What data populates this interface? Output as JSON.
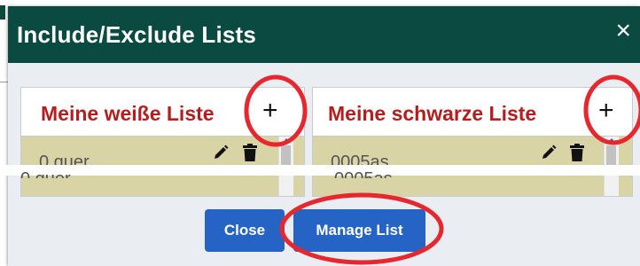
{
  "dialog": {
    "title": "Include/Exclude Lists",
    "close_glyph": "×"
  },
  "lists": [
    {
      "title": "Meine weiße Liste",
      "add_glyph": "+",
      "first_item": "0 quer",
      "edit_icon": "pencil-icon",
      "delete_icon": "trash-icon"
    },
    {
      "title": "Meine schwarze Liste",
      "add_glyph": "+",
      "first_item": "0005as",
      "edit_icon": "pencil-icon",
      "delete_icon": "trash-icon"
    }
  ],
  "footer": {
    "close_label": "Close",
    "manage_label": "Manage List"
  },
  "colors": {
    "header_bg": "#0b4a40",
    "list_title": "#b81d1d",
    "list_row_bg": "#d8d4a6",
    "button_bg": "#2564c5",
    "annotation": "#e8262d"
  },
  "annotations": {
    "type": "red-circle-highlights",
    "targets": [
      "add-plus-white-list",
      "add-plus-black-list",
      "manage-list-button"
    ]
  }
}
